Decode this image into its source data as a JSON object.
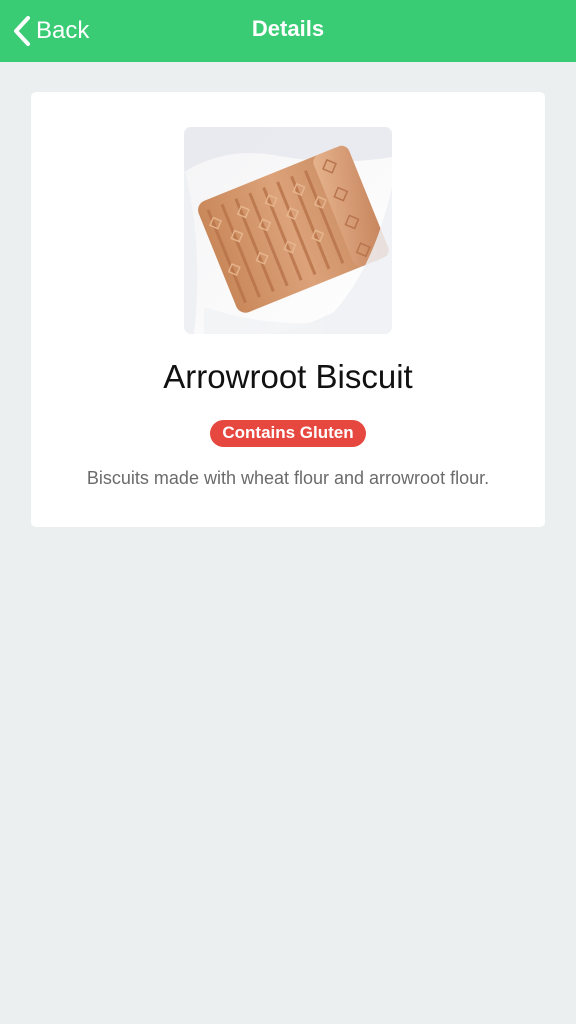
{
  "navbar": {
    "back_label": "Back",
    "title": "Details",
    "back_icon": "chevron-left-icon",
    "background_color": "#39cc74"
  },
  "item": {
    "name": "Arrowroot Biscuit",
    "badge": "Contains Gluten",
    "badge_color": "#e64840",
    "description": "Biscuits made with wheat flour and arrowroot flour."
  }
}
